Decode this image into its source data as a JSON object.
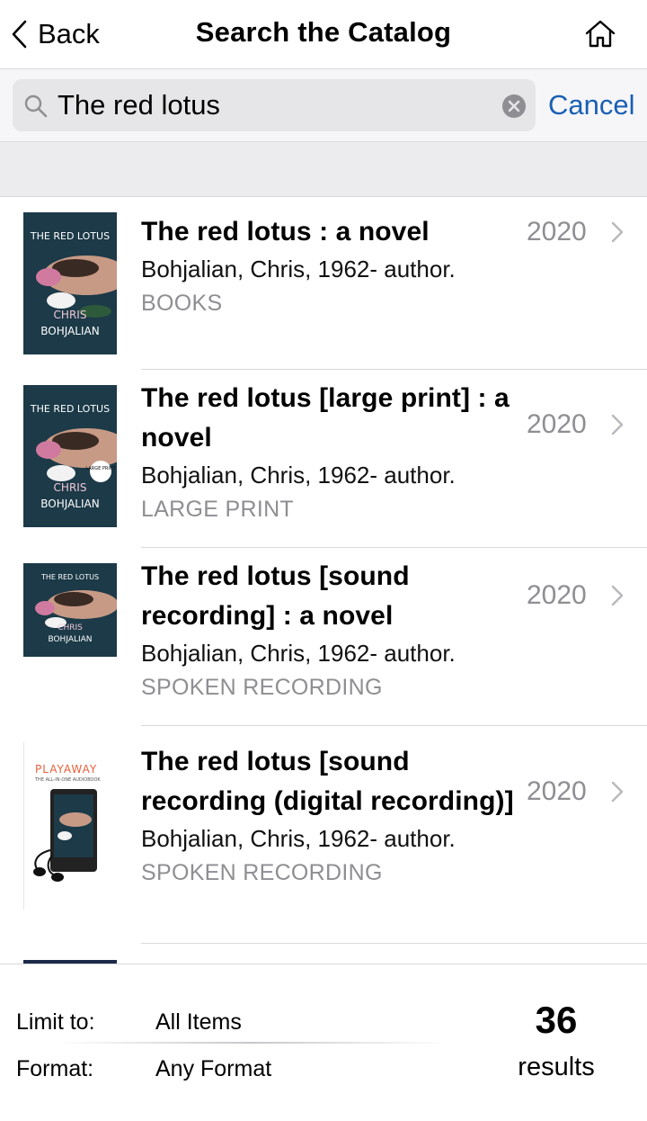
{
  "nav": {
    "back_label": "Back",
    "title": "Search the Catalog"
  },
  "search": {
    "value": "The red lotus",
    "cancel_label": "Cancel"
  },
  "results": [
    {
      "title": "The red lotus : a novel",
      "author": "Bohjalian, Chris, 1962- author.",
      "format": "BOOKS",
      "year": "2020",
      "cover": {
        "top_line": "THE RED LOTUS",
        "name_line1": "CHRIS",
        "name_line2": "BOHJALIAN"
      }
    },
    {
      "title": "The red lotus [large print] : a novel",
      "author": "Bohjalian, Chris, 1962- author.",
      "format": "LARGE PRINT",
      "year": "2020",
      "cover": {
        "top_line": "THE RED LOTUS",
        "name_line1": "CHRIS",
        "name_line2": "BOHJALIAN",
        "badge": "LARGE PRINT"
      }
    },
    {
      "title": "The red lotus [sound recording] : a novel",
      "author": "Bohjalian, Chris, 1962- author.",
      "format": "SPOKEN RECORDING",
      "year": "2020",
      "cover": {
        "top_line": "THE RED LOTUS",
        "name_line1": "CHRIS",
        "name_line2": "BOHJALIAN"
      }
    },
    {
      "title": "The red lotus [sound recording (digital recording)]",
      "author": "Bohjalian, Chris, 1962- author.",
      "format": "SPOKEN RECORDING",
      "year": "2020",
      "cover": {
        "brand": "PLAYAWAY",
        "tagline": "THE ALL-IN-ONE AUDIOBOOK"
      }
    }
  ],
  "filters": {
    "limit_label": "Limit to:",
    "limit_value": "All Items",
    "format_label": "Format:",
    "format_value": "Any Format"
  },
  "count": {
    "value": "36",
    "label": "results"
  },
  "colors": {
    "accent": "#1a5fb4",
    "secondary_text": "#8e8e93",
    "separator": "#d9d9dc",
    "cover_bg": "#1c3a48"
  }
}
